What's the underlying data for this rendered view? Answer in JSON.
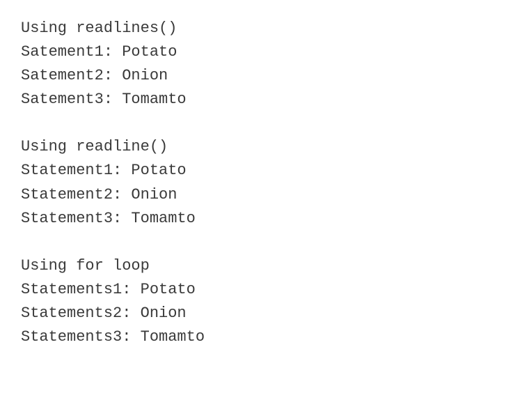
{
  "blocks": [
    {
      "header": "Using readlines()",
      "lines": [
        "Satement1: Potato",
        "Satement2: Onion",
        "Satement3: Tomamto"
      ]
    },
    {
      "header": "Using readline()",
      "lines": [
        "Statement1: Potato",
        "Statement2: Onion",
        "Statement3: Tomamto"
      ]
    },
    {
      "header": "Using for loop",
      "lines": [
        "Statements1: Potato",
        "Statements2: Onion",
        "Statements3: Tomamto"
      ]
    }
  ]
}
